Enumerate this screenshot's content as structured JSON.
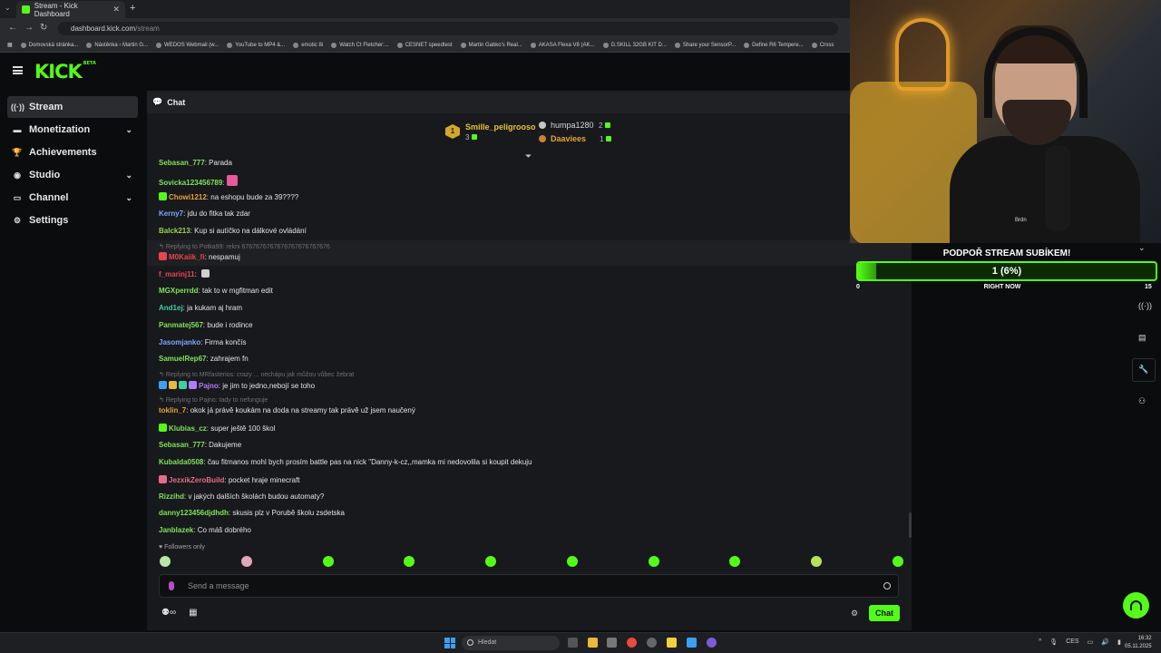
{
  "browser": {
    "tab_title": "Stream - Kick Dashboard",
    "url_host": "dashboard.kick.com",
    "url_path": "/stream",
    "bookmarks": [
      "Domovská stránka...",
      "Nástěnka ‹ Martin G...",
      "WEDOS Webmail (w...",
      "YouTube to MP4 &...",
      "emotic 8i",
      "Watch Ct Fletcher:...",
      "CESNET speedtest",
      "Martin Gabko's Real...",
      "AKASA Flexa V8 (AK...",
      "G.SKILL 32GB KIT D...",
      "Share your SensorP...",
      "Define R6 Tempere...",
      "Cross"
    ]
  },
  "header": {
    "logo": "KICK",
    "logo_sup": "BETA"
  },
  "sidebar": {
    "items": [
      {
        "label": "Stream",
        "icon": "broadcast-icon",
        "glyph": "((·))",
        "has_chevron": false
      },
      {
        "label": "Monetization",
        "icon": "money-icon",
        "glyph": "▬",
        "has_chevron": true
      },
      {
        "label": "Achievements",
        "icon": "trophy-icon",
        "glyph": "🏆",
        "has_chevron": false
      },
      {
        "label": "Studio",
        "icon": "video-camera-icon",
        "glyph": "◉",
        "has_chevron": true
      },
      {
        "label": "Channel",
        "icon": "channel-icon",
        "glyph": "▭",
        "has_chevron": true
      },
      {
        "label": "Settings",
        "icon": "gear-icon",
        "glyph": "⚙",
        "has_chevron": false
      }
    ]
  },
  "chat": {
    "title": "Chat",
    "leaderboard": {
      "rank1": {
        "rank": "1",
        "name": "Smille_peligrooso",
        "count": "3"
      },
      "rank2": {
        "name": "humpa1280",
        "count": "2"
      },
      "rank3": {
        "name": "Daaviees",
        "count": "1"
      }
    },
    "messages": [
      {
        "user": "Sebasan_777",
        "color": "#7ee35a",
        "text": "Parada"
      },
      {
        "user": "Sovicka123456789",
        "color": "#7ee35a",
        "text": ""
      },
      {
        "user": "Chowi1212",
        "color": "#e8a23a",
        "text": "na eshopu bude za 39????"
      },
      {
        "user": "Kerny7",
        "color": "#7ea6ff",
        "text": "jdu do fitka tak zdar"
      },
      {
        "user": "Balck213",
        "color": "#9bd24b",
        "text": "Kup si autíčko na dálkové ovládání"
      },
      {
        "user": "M0Kaiik_fi",
        "color": "#e8454f",
        "text": "nespamuj"
      },
      {
        "user": "f_marinj11",
        "color": "#e8454f",
        "text": ""
      },
      {
        "user": "MGXperrdd",
        "color": "#7ee35a",
        "text": "tak to w mgfitman edit"
      },
      {
        "user": "And1ej",
        "color": "#3ecfa1",
        "text": "ja kukam aj hram"
      },
      {
        "user": "Panmatej567",
        "color": "#7ee35a",
        "text": "bude i rodince"
      },
      {
        "user": "Jasomjanko",
        "color": "#7ea6ff",
        "text": "Firma končís"
      },
      {
        "user": "SamuelRep67",
        "color": "#7ee35a",
        "text": "zahrajem fn"
      },
      {
        "user": "Pajno",
        "color": "#b07cff",
        "text": "je jim to jedno,nebojí se toho"
      },
      {
        "user": "toklin_7",
        "color": "#e8a23a",
        "text": "okok já právě koukám na doda na streamy tak právě už jsem naučený"
      },
      {
        "user": "Klubias_cz",
        "color": "#7ee35a",
        "text": "super ještě 100 škol"
      },
      {
        "user": "Sebasan_777",
        "color": "#7ee35a",
        "text": "Dakujeme"
      },
      {
        "user": "Kubalda0508",
        "color": "#7ee35a",
        "text": "čau fitmanos mohl bych prosím battle pas na nick \"Danny-k-cz,,mamka mi nedovolila si koupit dekuju"
      },
      {
        "user": "JezxikZeroBuild",
        "color": "#e86a8a",
        "text": "pocket hraje minecraft"
      },
      {
        "user": "Rizzihd",
        "color": "#7ee35a",
        "text": "v jakých dalších školách budou automaty?"
      },
      {
        "user": "danny123456djdhdh",
        "color": "#7ee35a",
        "text": "skusis plz v Porubě školu zsdetska"
      },
      {
        "user": "Janblazek",
        "color": "#7ee35a",
        "text": "Co máš dobrého"
      }
    ],
    "replies": [
      "Replying to Potka99: rekni 6767676767676767676767676",
      "Replying to MRfasterios: crazy ... nechápu jak můžou vůbec žebrat",
      "Replying to Pajno: tady to nefunguje"
    ],
    "followers_only": "Followers only",
    "input_placeholder": "Send a message",
    "chat_button": "Chat"
  },
  "subgoal": {
    "title": "PODPOŘ STREAM SUBÍKEM!",
    "progress_text": "1 (6%)",
    "progress_fraction": 0.06,
    "min": "0",
    "max": "15",
    "status": "RIGHT NOW"
  },
  "webcam": {
    "shirt_text": "Brdn"
  },
  "taskbar": {
    "search": "Hledat",
    "lang": "CES",
    "time": "16:32",
    "date": "05.11.2025"
  },
  "colors": {
    "accent": "#53fc18",
    "background": "#0b0c0e",
    "panel": "#18191c"
  }
}
